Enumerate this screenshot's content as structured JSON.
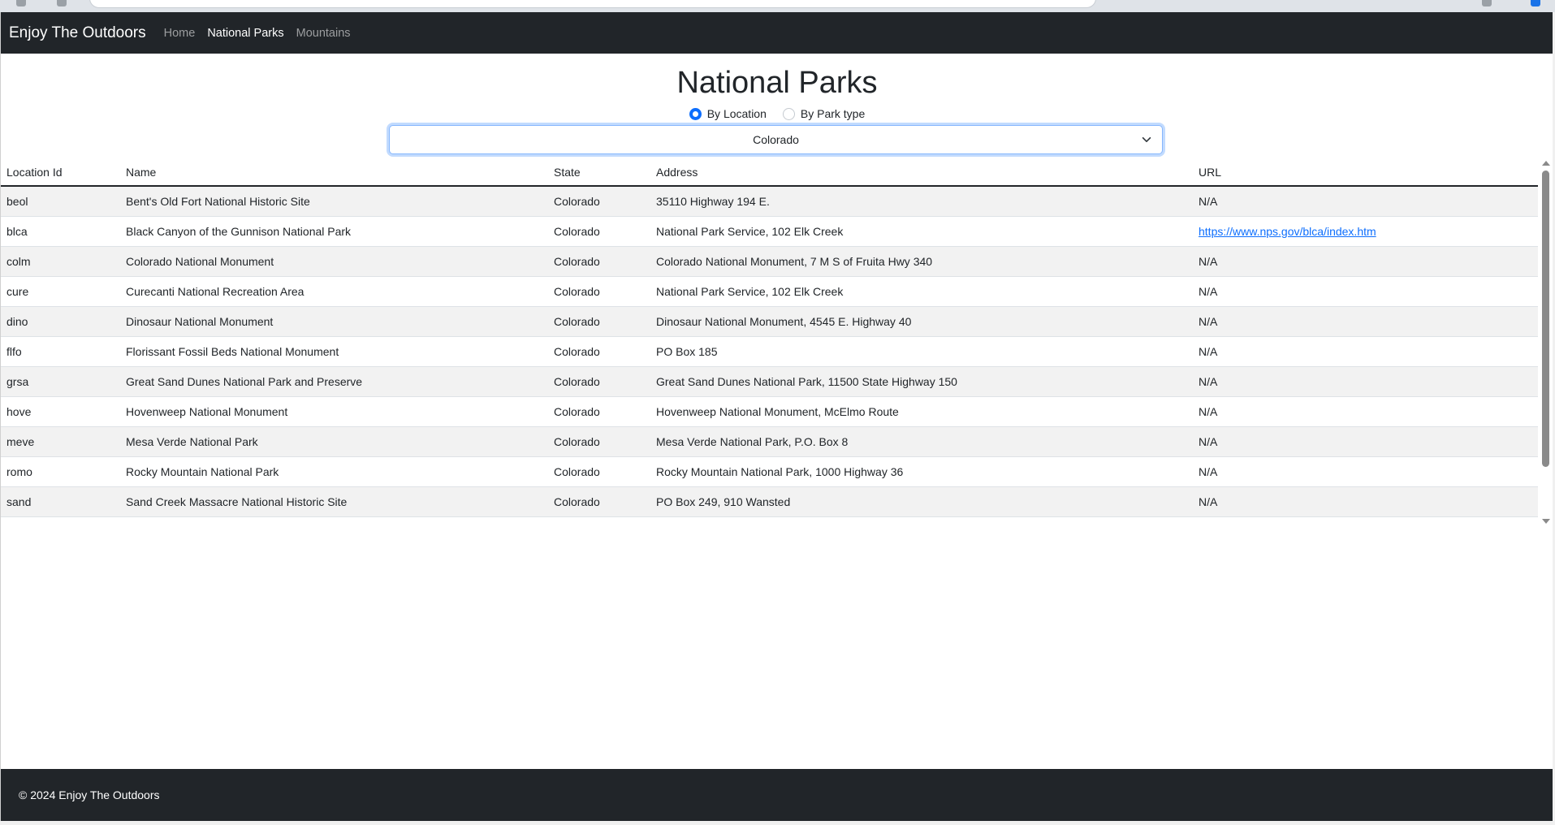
{
  "navbar": {
    "brand": "Enjoy The Outdoors",
    "links": [
      {
        "label": "Home",
        "active": false
      },
      {
        "label": "National Parks",
        "active": true
      },
      {
        "label": "Mountains",
        "active": false
      }
    ]
  },
  "page": {
    "title": "National Parks"
  },
  "filter": {
    "options": [
      {
        "label": "By Location",
        "checked": true
      },
      {
        "label": "By Park type",
        "checked": false
      }
    ],
    "selected_value": "Colorado"
  },
  "table": {
    "headers": [
      "Location Id",
      "Name",
      "State",
      "Address",
      "URL"
    ],
    "rows": [
      {
        "id": "beol",
        "name": "Bent's Old Fort National Historic Site",
        "state": "Colorado",
        "address": "35110 Highway 194 E.",
        "url": "N/A"
      },
      {
        "id": "blca",
        "name": "Black Canyon of the Gunnison National Park",
        "state": "Colorado",
        "address": "National Park Service, 102 Elk Creek",
        "url": "https://www.nps.gov/blca/index.htm"
      },
      {
        "id": "colm",
        "name": "Colorado National Monument",
        "state": "Colorado",
        "address": "Colorado National Monument, 7 M S of Fruita Hwy 340",
        "url": "N/A"
      },
      {
        "id": "cure",
        "name": "Curecanti National Recreation Area",
        "state": "Colorado",
        "address": "National Park Service, 102 Elk Creek",
        "url": "N/A"
      },
      {
        "id": "dino",
        "name": "Dinosaur National Monument",
        "state": "Colorado",
        "address": "Dinosaur National Monument, 4545 E. Highway 40",
        "url": "N/A"
      },
      {
        "id": "flfo",
        "name": "Florissant Fossil Beds National Monument",
        "state": "Colorado",
        "address": "PO Box 185",
        "url": "N/A"
      },
      {
        "id": "grsa",
        "name": "Great Sand Dunes National Park and Preserve",
        "state": "Colorado",
        "address": "Great Sand Dunes National Park, 11500 State Highway 150",
        "url": "N/A"
      },
      {
        "id": "hove",
        "name": "Hovenweep National Monument",
        "state": "Colorado",
        "address": "Hovenweep National Monument, McElmo Route",
        "url": "N/A"
      },
      {
        "id": "meve",
        "name": "Mesa Verde National Park",
        "state": "Colorado",
        "address": "Mesa Verde National Park, P.O. Box 8",
        "url": "N/A"
      },
      {
        "id": "romo",
        "name": "Rocky Mountain National Park",
        "state": "Colorado",
        "address": "Rocky Mountain National Park, 1000 Highway 36",
        "url": "N/A"
      },
      {
        "id": "sand",
        "name": "Sand Creek Massacre National Historic Site",
        "state": "Colorado",
        "address": "PO Box 249, 910 Wansted",
        "url": "N/A"
      }
    ]
  },
  "footer": {
    "text": "© 2024 Enjoy The Outdoors"
  }
}
